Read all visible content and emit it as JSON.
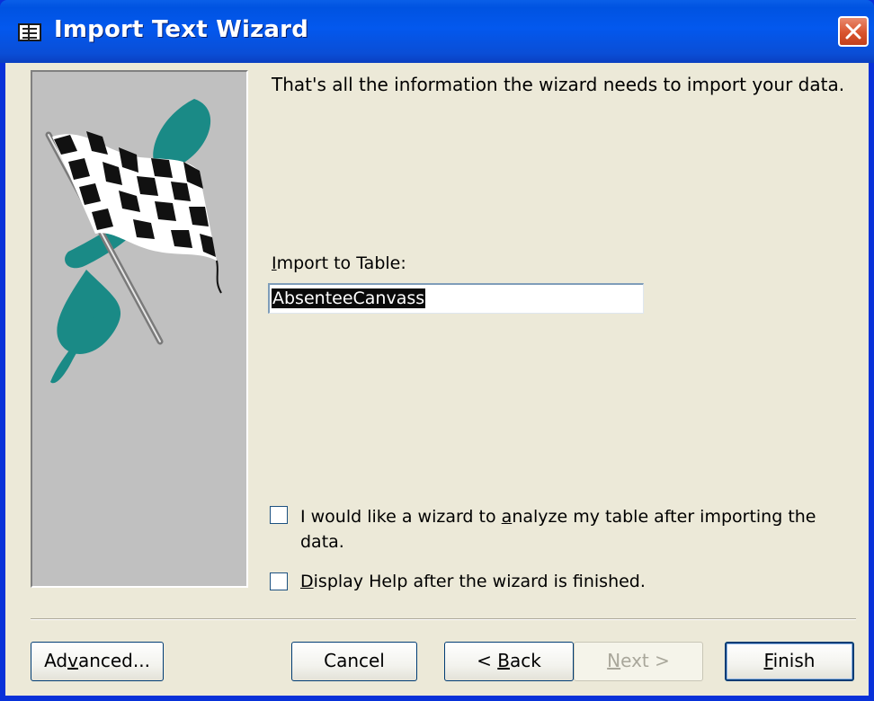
{
  "window": {
    "title": "Import Text Wizard"
  },
  "info": {
    "text": "That's all the information the wizard needs to import your data."
  },
  "import_table": {
    "label_pre": "",
    "label_u": "I",
    "label_post": "mport to Table:",
    "value": "AbsenteeCanvass"
  },
  "options": {
    "analyze": {
      "checked": false,
      "line1_pre": "I would like a wizard to ",
      "line1_u": "a",
      "line1_post": "nalyze my table after importing the",
      "line2": "data."
    },
    "display_help": {
      "checked": false,
      "u": "D",
      "post": "isplay Help after the wizard is finished."
    }
  },
  "buttons": {
    "advanced": {
      "pre": "Ad",
      "u": "v",
      "post": "anced..."
    },
    "cancel": {
      "label": "Cancel"
    },
    "back": {
      "pre": "< ",
      "u": "B",
      "post": "ack"
    },
    "next": {
      "u": "N",
      "post": "ext >"
    },
    "finish": {
      "u": "F",
      "post": "inish"
    }
  },
  "colors": {
    "titlebar": "#0055e5",
    "dialog_bg": "#ece9d8",
    "picture_bg": "#c0c0c0",
    "brush_teal": "#1a8a86"
  }
}
